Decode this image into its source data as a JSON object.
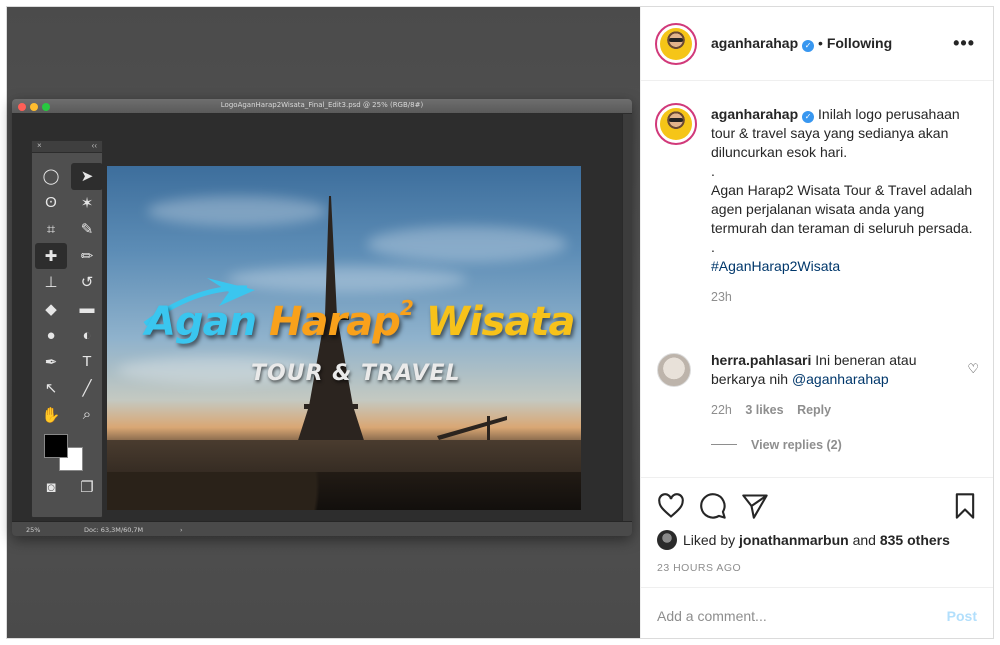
{
  "photoshop": {
    "window_title": "LogoAganHarap2Wisata_Final_Edit3.psd @ 25% (RGB/8#)",
    "zoom": "25%",
    "doc_size": "Doc: 63,3M/60,7M",
    "logo": {
      "word1": "Agan",
      "word2": "Harap",
      "superscript": "2",
      "word3": "Wisata",
      "subtitle": "TOUR & TRAVEL"
    },
    "colors": {
      "logo_blue": "#3ac6ef",
      "logo_orange": "#f9a11b",
      "logo_yellow": "#f7c21a"
    }
  },
  "post": {
    "author": "aganharahap",
    "follow_status": "Following",
    "caption_lines": [
      "Inilah logo perusahaan tour & travel saya yang sedianya akan diluncurkan esok hari.",
      ".",
      "Agan Harap2 Wisata Tour & Travel adalah agen perjalanan wisata anda yang termurah dan teraman di seluruh persada.",
      "."
    ],
    "hashtag": "#AganHarap2Wisata",
    "caption_time": "23h"
  },
  "comment": {
    "author": "herra.pahlasari",
    "text": "Ini beneran atau berkarya nih",
    "mention": "@aganharahap",
    "time": "22h",
    "likes": "3 likes",
    "reply": "Reply",
    "view_replies": "View replies (2)"
  },
  "engagement": {
    "liked_by_prefix": "Liked by",
    "liked_by_user": "jonathanmarbun",
    "liked_by_joiner": "and",
    "liked_by_others": "835 others",
    "time_ago": "23 HOURS AGO"
  },
  "comment_box": {
    "placeholder": "Add a comment...",
    "post_label": "Post"
  },
  "icons": [
    "heart-icon",
    "comment-icon",
    "share-icon",
    "bookmark-icon",
    "more-options-icon",
    "verified-badge-icon"
  ],
  "colors": {
    "link": "#00376b",
    "meta_gray": "#8e8e8e",
    "post_button_disabled": "#b2dffc",
    "verified": "#3897f0"
  }
}
